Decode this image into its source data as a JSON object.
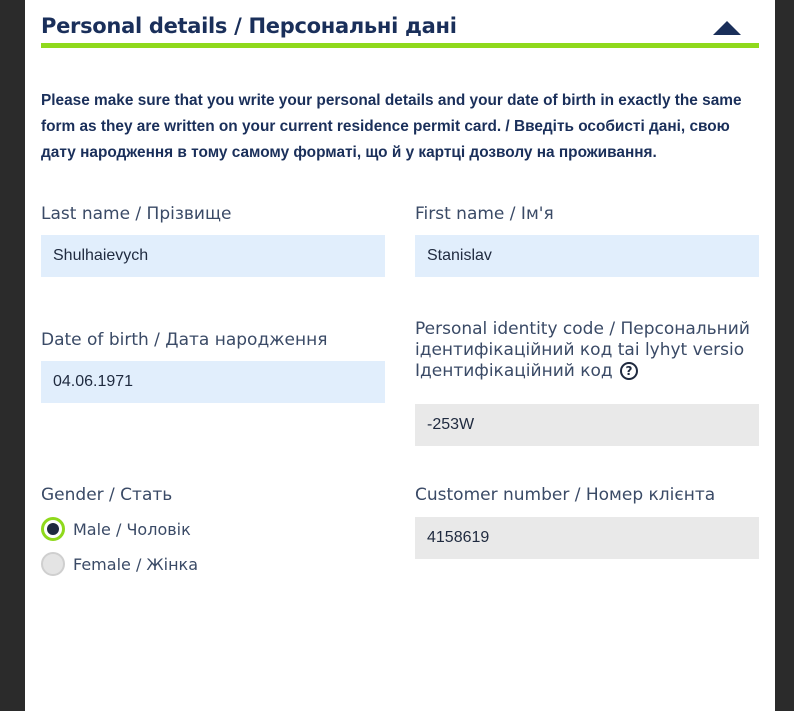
{
  "section": {
    "title": "Personal details / Персональні дані",
    "collapse_icon": "chevron-up-icon",
    "accent_color": "#8fd91c",
    "intro": "Please make sure that you write your personal details and your date of birth in exactly the same form as they are written on your current residence permit card. / Введіть особисті дані, свою дату народження в тому самому форматі, що й у картці дозволу на проживання."
  },
  "fields": {
    "last_name": {
      "label": "Last name / Прізвище",
      "value": "Shulhaievych"
    },
    "first_name": {
      "label": "First name / Ім'я",
      "value": "Stanislav"
    },
    "date_of_birth": {
      "label": "Date of birth / Дата народження",
      "value": "04.06.1971"
    },
    "identity_code": {
      "label": "Personal identity code / Персональний ідентифікаційний код tai lyhyt versio Ідентифікаційний код",
      "help": "?",
      "value": "-253W"
    },
    "gender": {
      "label": "Gender / Стать",
      "options": [
        {
          "label": "Male / Чоловік",
          "selected": true
        },
        {
          "label": "Female / Жінка",
          "selected": false
        }
      ]
    },
    "customer_number": {
      "label": "Customer number / Номер клієнта",
      "value": "4158619"
    }
  }
}
